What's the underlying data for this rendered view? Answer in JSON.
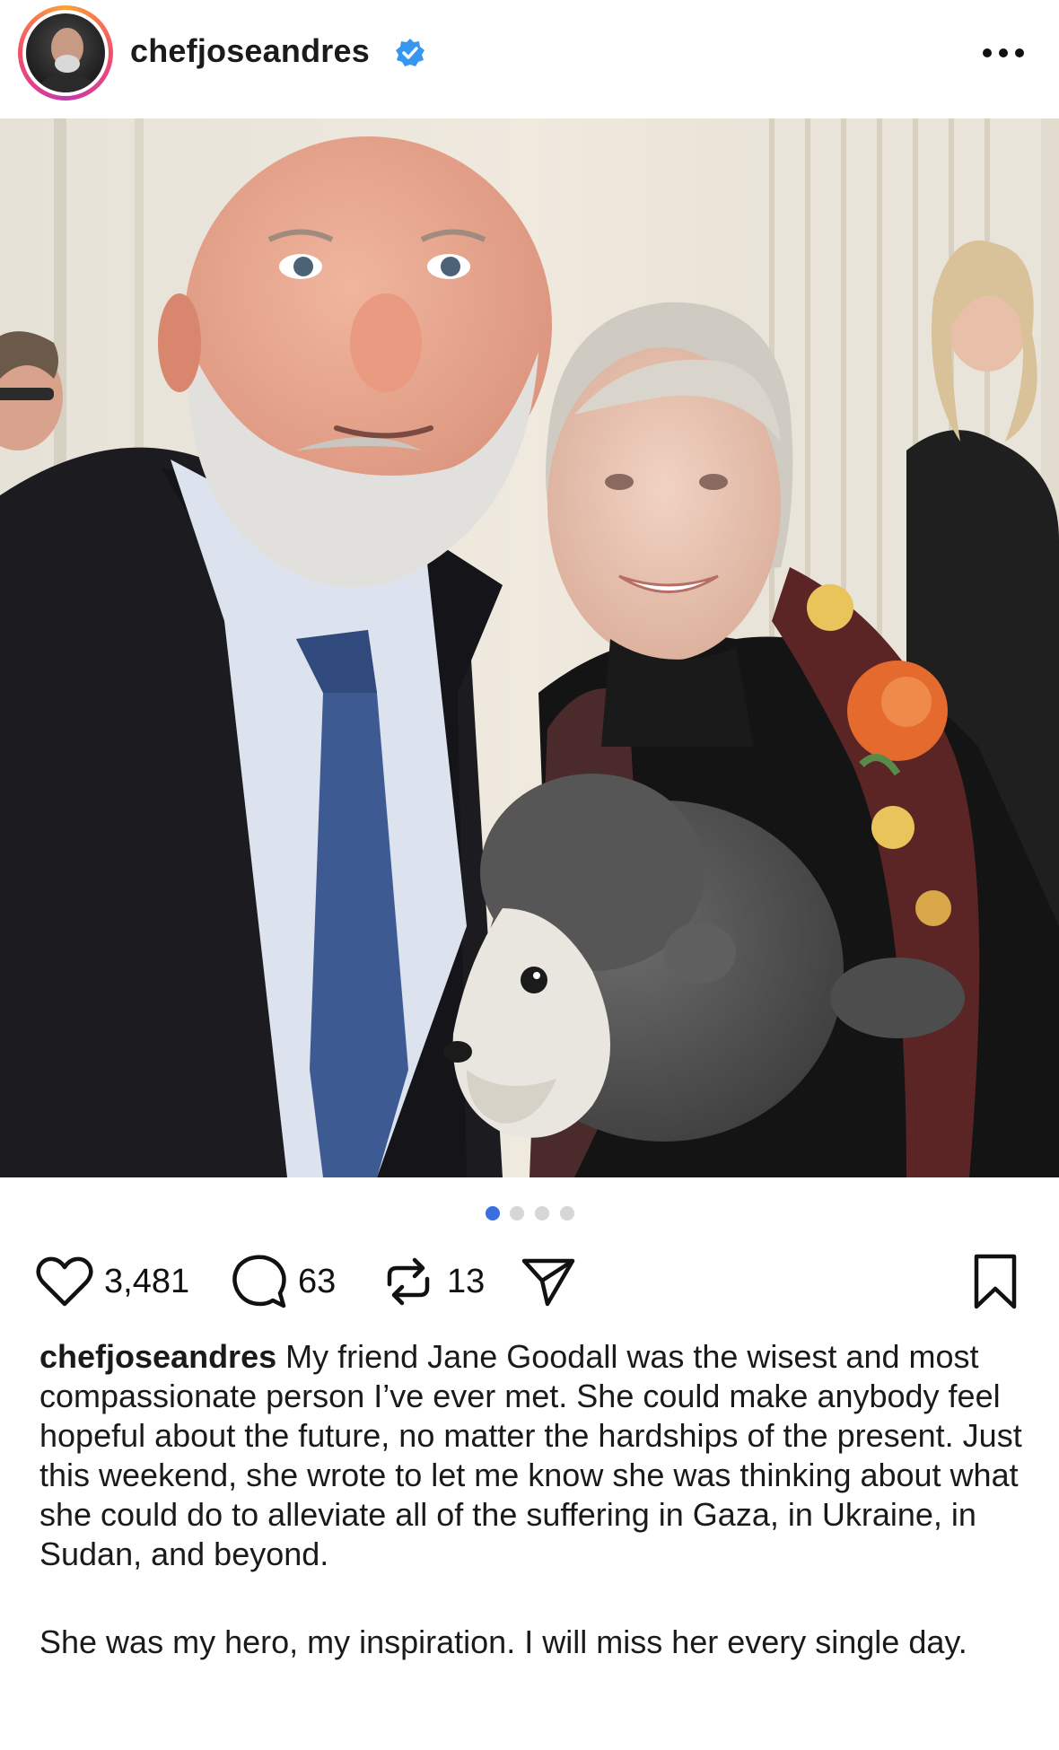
{
  "post": {
    "username": "chefjoseandres",
    "verified": true,
    "images_count": 4,
    "active_image": 1,
    "likes": "3,481",
    "comments": "63",
    "reposts": "13",
    "caption_user": "chefjoseandres",
    "caption_paragraph_1": "My friend Jane Goodall was the wisest and most compassionate person I’ve ever met. She could make anybody feel hopeful about the future, no matter the hardships of the present. Just this weekend, she wrote to let me know she was thinking about what she could do to alleviate all of the suffering in Gaza, in Ukraine, in Sudan, and beyond.",
    "caption_paragraph_2": "She was my hero, my inspiration. I will miss her every single day."
  },
  "icons": {
    "verified": "verified-badge-icon",
    "more": "more-options-icon",
    "like": "heart-icon",
    "comment": "comment-icon",
    "repost": "repost-icon",
    "share": "send-icon",
    "save": "bookmark-icon"
  },
  "colors": {
    "verified_blue": "#3797f0",
    "active_dot": "#3b6fe0",
    "inactive_dot": "#d6d6d6",
    "avatar_ring": "#e1306c"
  }
}
